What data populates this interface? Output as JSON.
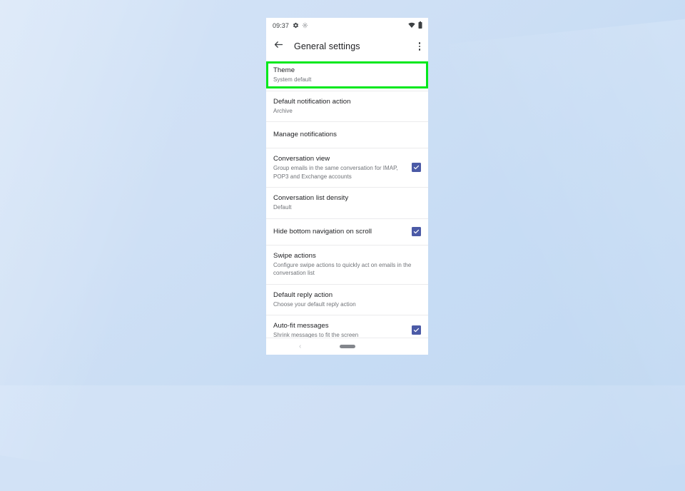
{
  "colors": {
    "highlight_green": "#00e81c",
    "checkbox_blue": "#4b5aa6",
    "title_text": "#202124",
    "subtitle_text": "#6f7277",
    "background_blue": "#cfe0f5"
  },
  "status_bar": {
    "time": "09:37",
    "left_icons": [
      "gear-icon",
      "settings-sync-icon"
    ],
    "right_icons": [
      "wifi-icon",
      "battery-icon"
    ]
  },
  "app_bar": {
    "back_label": "Back",
    "title": "General settings",
    "overflow_label": "More options"
  },
  "settings": {
    "rows": [
      {
        "name": "theme",
        "title": "Theme",
        "subtitle": "System default",
        "checkbox": false,
        "highlighted": true
      },
      {
        "name": "default-notification-action",
        "title": "Default notification action",
        "subtitle": "Archive",
        "checkbox": false,
        "highlighted": false
      },
      {
        "name": "manage-notifications",
        "title": "Manage notifications",
        "subtitle": "",
        "checkbox": false,
        "highlighted": false
      },
      {
        "name": "conversation-view",
        "title": "Conversation view",
        "subtitle": "Group emails in the same conversation for IMAP, POP3 and Exchange accounts",
        "checkbox": true,
        "checked": true,
        "highlighted": false
      },
      {
        "name": "conversation-list-density",
        "title": "Conversation list density",
        "subtitle": "Default",
        "checkbox": false,
        "highlighted": false
      },
      {
        "name": "hide-bottom-navigation-on-scroll",
        "title": "Hide bottom navigation on scroll",
        "subtitle": "",
        "checkbox": true,
        "checked": true,
        "highlighted": false
      },
      {
        "name": "swipe-actions",
        "title": "Swipe actions",
        "subtitle": "Configure swipe actions to quickly act on emails in the conversation list",
        "checkbox": false,
        "highlighted": false
      },
      {
        "name": "default-reply-action",
        "title": "Default reply action",
        "subtitle": "Choose your default reply action",
        "checkbox": false,
        "highlighted": false
      },
      {
        "name": "auto-fit-messages",
        "title": "Auto-fit messages",
        "subtitle": "Shrink messages to fit the screen",
        "checkbox": true,
        "checked": true,
        "highlighted": false
      }
    ]
  },
  "nav_bar": {
    "back_glyph": "‹",
    "home_indicator": "home-pill"
  }
}
